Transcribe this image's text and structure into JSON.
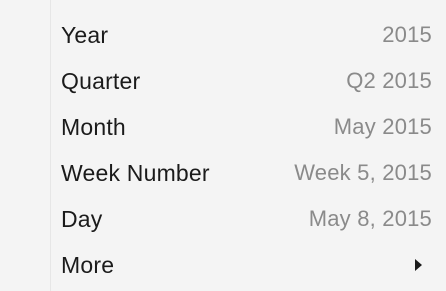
{
  "menu": {
    "items": [
      {
        "label": "Year",
        "value": "2015"
      },
      {
        "label": "Quarter",
        "value": "Q2 2015"
      },
      {
        "label": "Month",
        "value": "May 2015"
      },
      {
        "label": "Week Number",
        "value": "Week 5, 2015"
      },
      {
        "label": "Day",
        "value": "May 8, 2015"
      },
      {
        "label": "More",
        "submenu_icon": "chevron-right-icon"
      }
    ]
  }
}
